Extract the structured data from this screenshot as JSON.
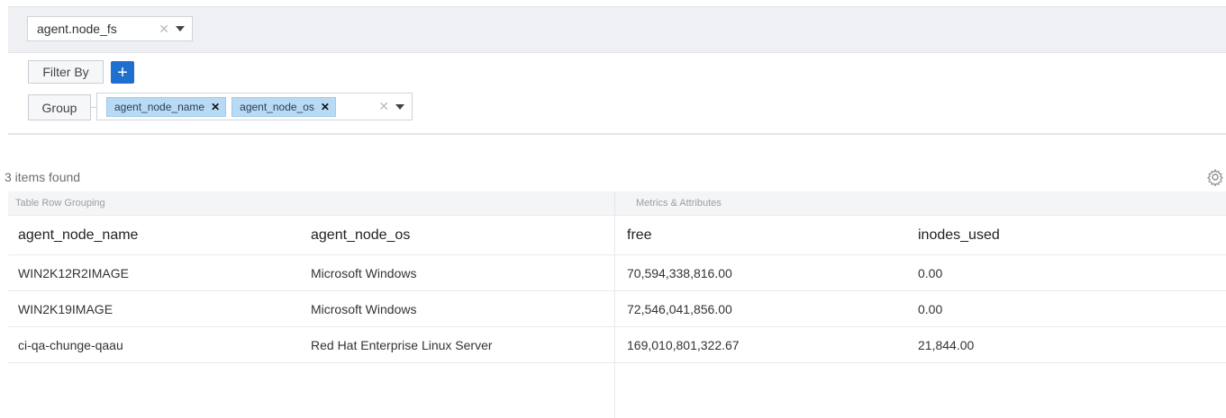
{
  "query": {
    "source_value": "agent.node_fs",
    "filter_label": "Filter By",
    "add_button_label": "+",
    "group_label": "Group",
    "group_tags": [
      "agent_node_name",
      "agent_node_os"
    ],
    "clear_symbol": "✕"
  },
  "results": {
    "status_text": "3 items found",
    "group_headers": {
      "left": "Table Row Grouping",
      "right": "Metrics & Attributes"
    },
    "columns": [
      "agent_node_name",
      "agent_node_os",
      "free",
      "inodes_used"
    ],
    "rows": [
      [
        "WIN2K12R2IMAGE",
        "Microsoft Windows",
        "70,594,338,816.00",
        "0.00"
      ],
      [
        "WIN2K19IMAGE",
        "Microsoft Windows",
        "72,546,041,856.00",
        "0.00"
      ],
      [
        "ci-qa-chunge-qaau",
        "Red Hat Enterprise Linux Server",
        "169,010,801,322.67",
        "21,844.00"
      ]
    ]
  },
  "icons": {
    "settings": "gear-icon",
    "dropdown": "chevron-down-icon",
    "clear": "clear-icon",
    "remove_tag": "remove-tag-icon"
  },
  "colors": {
    "accent": "#1f6fcf",
    "tag_bg": "#b8daf5",
    "band_bg": "#eef0f3"
  }
}
